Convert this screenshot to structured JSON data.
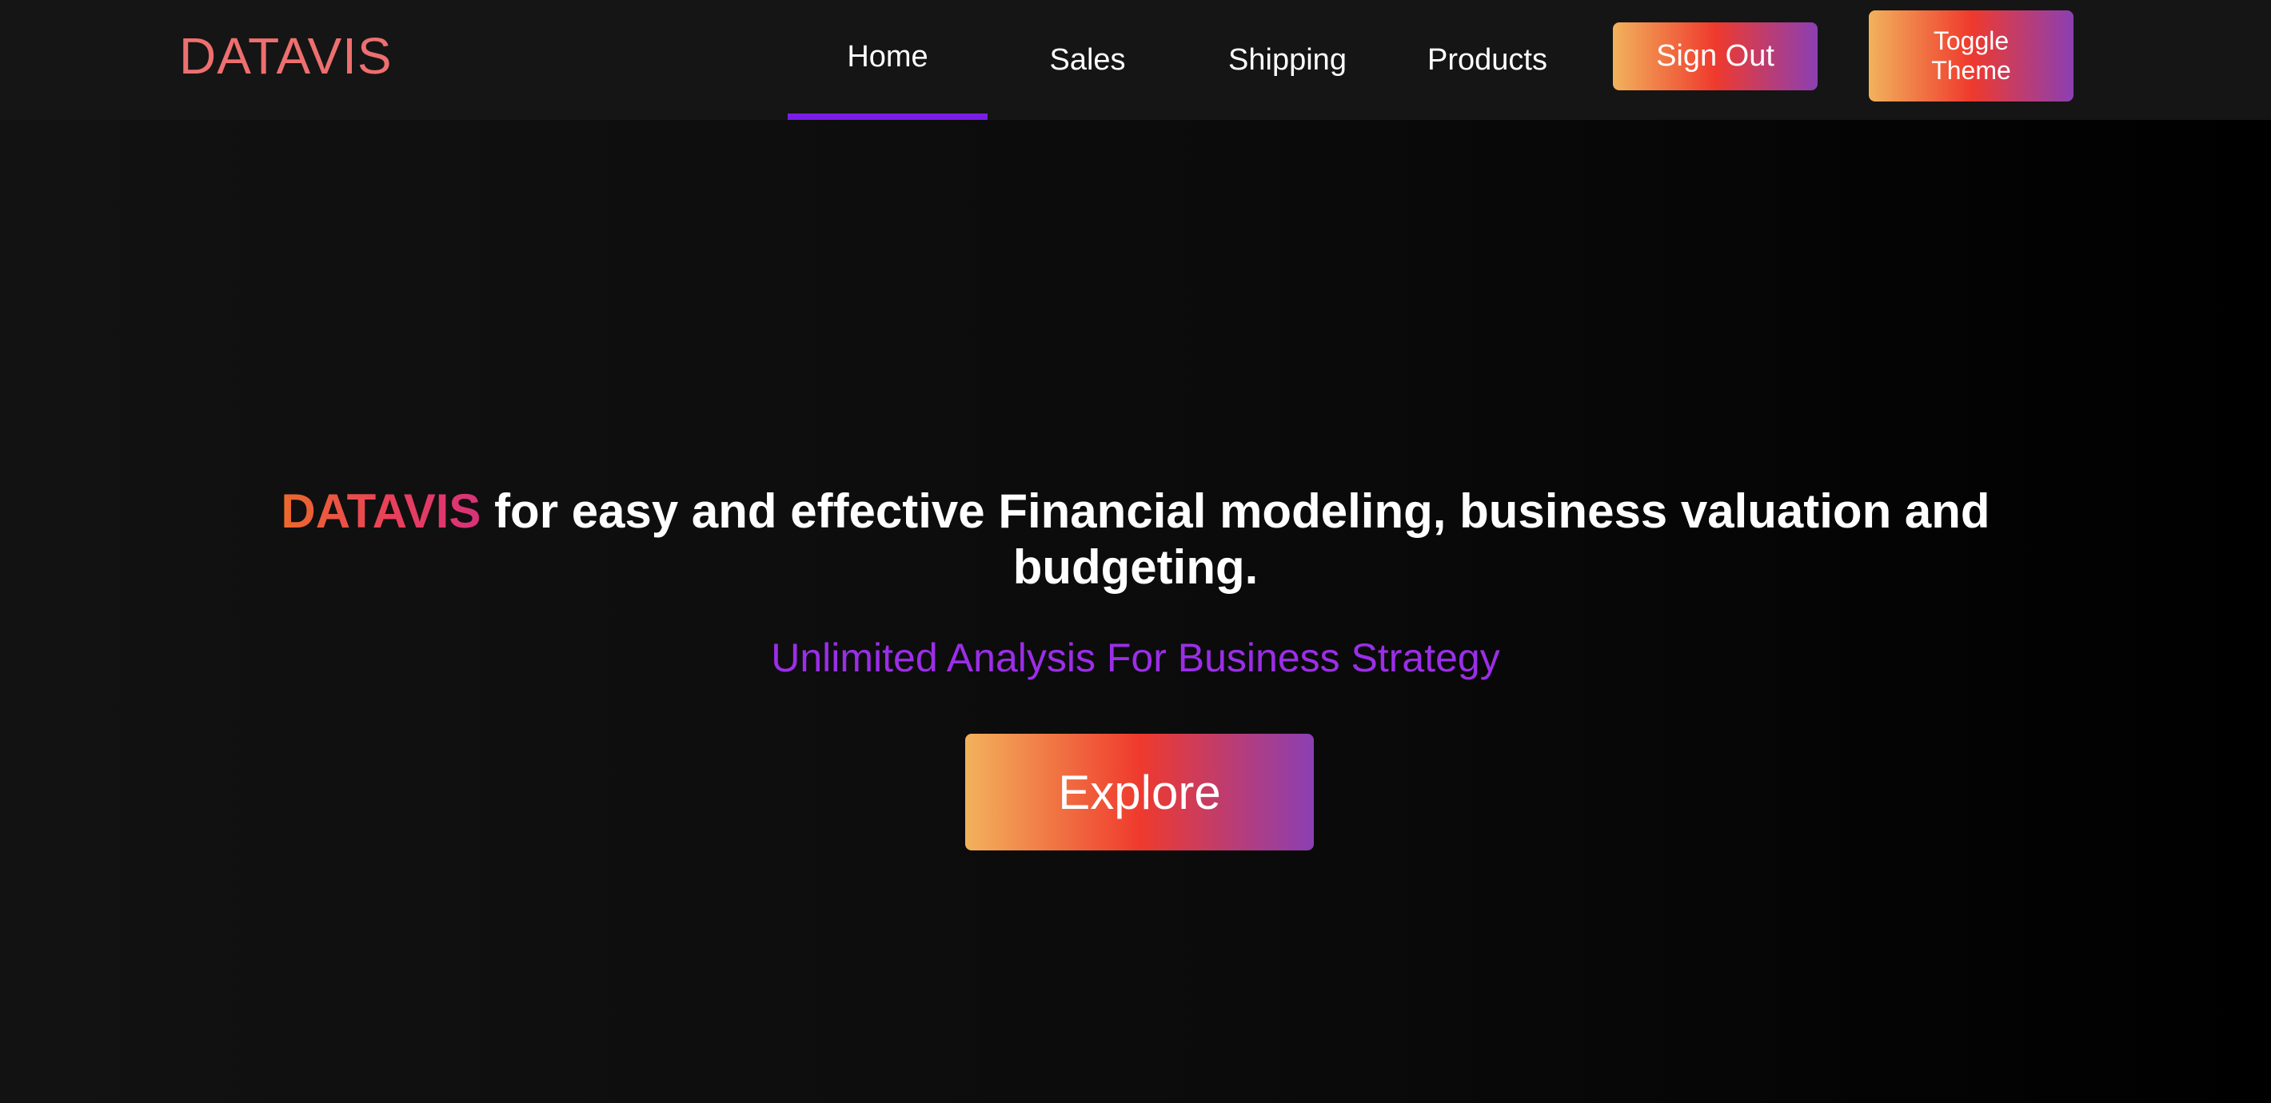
{
  "navbar": {
    "logo": "DATAVIS",
    "links": [
      {
        "label": "Home",
        "active": true
      },
      {
        "label": "Sales",
        "active": false
      },
      {
        "label": "Shipping",
        "active": false
      },
      {
        "label": "Products",
        "active": false
      }
    ],
    "sign_out_label": "Sign Out",
    "toggle_theme_label": "Toggle\nTheme"
  },
  "hero": {
    "brand": "DATAVIS",
    "title_rest": " for easy and effective Financial modeling, business valuation and budgeting.",
    "subtitle": "Unlimited Analysis For Business Strategy",
    "explore_label": "Explore"
  },
  "colors": {
    "logo": "#ee6f6f",
    "active_underline": "#7a1ee6",
    "subtitle": "#9b2ee8",
    "button_gradient": [
      "#f2b25c",
      "#ef3a2d",
      "#8b3fb3"
    ]
  }
}
